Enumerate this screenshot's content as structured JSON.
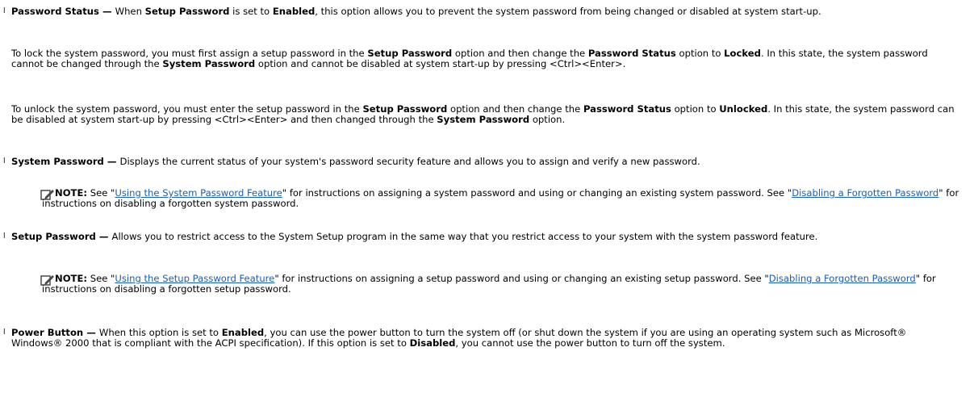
{
  "bullet_glyph": "l",
  "password_status": {
    "term": "Password Status",
    "dash": " — ",
    "t1": "When ",
    "b1": "Setup Password",
    "t2": " is set to ",
    "b2": "Enabled",
    "t3": ", this option allows you to prevent the system password from being changed or disabled at system start-up.",
    "p1_t1": "To lock the system password, you must first assign a setup password in the ",
    "p1_b1": "Setup Password",
    "p1_t2": " option and then change the ",
    "p1_b2": "Password Status",
    "p1_t3": " option to ",
    "p1_b3": "Locked",
    "p1_t4": ". In this state, the system password cannot be changed through the ",
    "p1_b4": "System Password",
    "p1_t5": " option and cannot be disabled at system start-up by pressing <Ctrl><Enter>.",
    "p2_t1": "To unlock the system password, you must enter the setup password in the ",
    "p2_b1": "Setup Password",
    "p2_t2": " option and then change the ",
    "p2_b2": "Password Status",
    "p2_t3": " option to ",
    "p2_b3": "Unlocked",
    "p2_t4": ". In this state, the system password can be disabled at system start-up by pressing <Ctrl><Enter> and then changed through the ",
    "p2_b4": "System Password",
    "p2_t5": " option."
  },
  "system_password": {
    "term": "System Password",
    "dash": " — ",
    "text": "Displays the current status of your system's password security feature and allows you to assign and verify a new password.",
    "note": {
      "label": "NOTE:",
      "t1": " See \"",
      "link1": "Using the System Password Feature",
      "t2": "\" for instructions on assigning a system password and using or changing an existing system password. See \"",
      "link2": "Disabling a Forgotten Password",
      "t3": "\" for instructions on disabling a forgotten system password."
    }
  },
  "setup_password": {
    "term": "Setup Password",
    "dash": " — ",
    "text": "Allows you to restrict access to the System Setup program in the same way that you restrict access to your system with the system password feature.",
    "note": {
      "label": "NOTE:",
      "t1": " See \"",
      "link1": "Using the Setup Password Feature",
      "t2": "\" for instructions on assigning a setup password and using or changing an existing setup password. See \"",
      "link2": "Disabling a Forgotten Password",
      "t3": "\" for instructions on disabling a forgotten setup password."
    }
  },
  "power_button": {
    "term": "Power Button",
    "dash": " — ",
    "t1": "When this option is set to ",
    "b1": "Enabled",
    "t2": ", you can use the power button to turn the system off (or shut down the system if you are using an operating system such as Microsoft® Windows® 2000 that is compliant with the ACPI specification). If this option is set to ",
    "b2": "Disabled",
    "t3": ", you cannot use the power button to turn off the system."
  },
  "colors": {
    "text": "#000000",
    "link": "#1a5fb4",
    "note_icon": "#4a4a4a"
  },
  "icons": {
    "note": "pencil-note-icon",
    "bullet": "bullet-icon"
  }
}
